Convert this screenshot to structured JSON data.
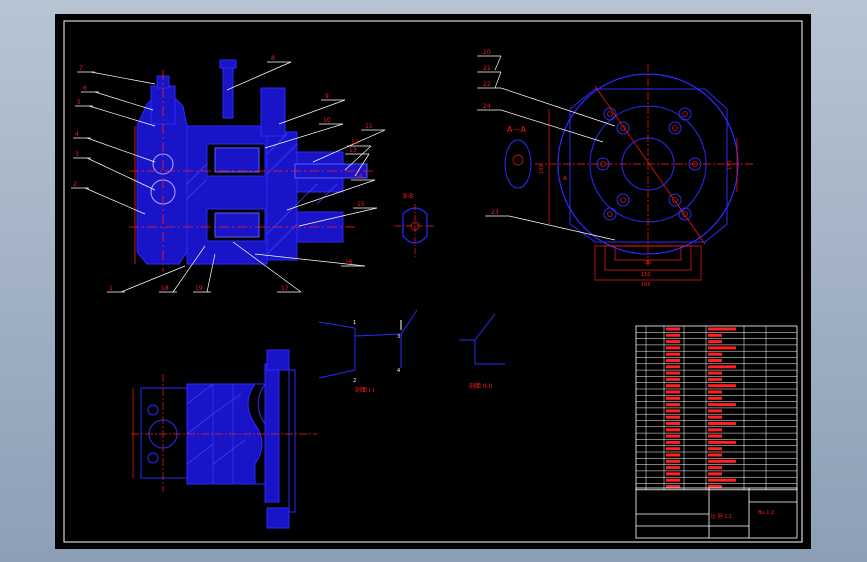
{
  "colors": {
    "background": "#000000",
    "part_fill": "#1a14c8",
    "part_stroke": "#2a2aff",
    "dimension": "#ff1a1a",
    "leader": "#ffffff",
    "border": "#ffffff",
    "table_line": "#ffffff",
    "table_text": "#ff2020"
  },
  "balloons_left": [
    "7",
    "6",
    "5",
    "4",
    "3",
    "2",
    "8",
    "9",
    "10",
    "11",
    "12",
    "13",
    "14",
    "15",
    "16",
    "17",
    "1",
    "18",
    "19"
  ],
  "balloons_right": [
    "20",
    "21",
    "22",
    "24",
    "23"
  ],
  "section_labels": {
    "aa": "A－A",
    "bb": "B-B",
    "ellipse_b": "B"
  },
  "dims_right": [
    "100",
    "140",
    "20",
    "150",
    "165"
  ],
  "sections": {
    "s1_label": "剖面 I-I",
    "s2_label": "剖面 II-II",
    "s1_points": [
      "1",
      "2",
      "3",
      "4"
    ]
  },
  "title_block": {
    "scale": "比 例 1:1",
    "code": "Bu 1:2"
  }
}
